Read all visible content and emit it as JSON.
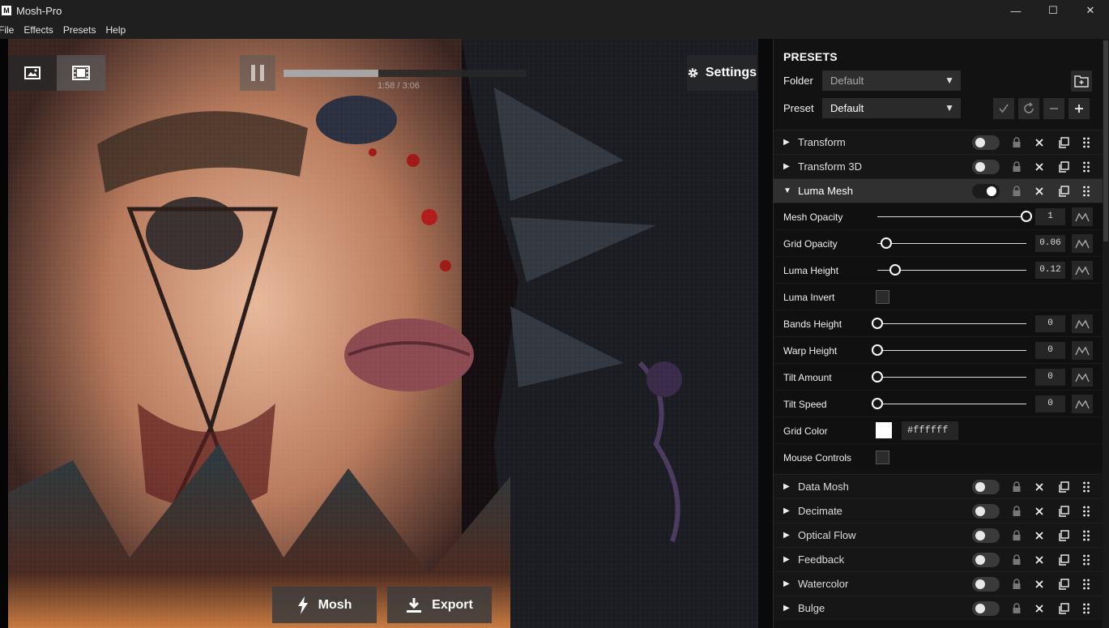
{
  "window": {
    "logo_letter": "M",
    "title": "Mosh-Pro",
    "minimize": "—",
    "maximize": "☐",
    "close": "✕"
  },
  "menu": [
    "File",
    "Effects",
    "Presets",
    "Help"
  ],
  "player": {
    "time": "1:58 / 3:06",
    "progress": 0.39,
    "settings_label": "Settings",
    "mosh_label": "Mosh",
    "export_label": "Export"
  },
  "presets": {
    "title": "PRESETS",
    "folder_label": "Folder",
    "folder_value": "Default",
    "preset_label": "Preset",
    "preset_value": "Default",
    "caret": "▼"
  },
  "effects_top": [
    {
      "name": "Transform",
      "enabled": false,
      "expanded": false
    },
    {
      "name": "Transform 3D",
      "enabled": false,
      "expanded": false
    },
    {
      "name": "Luma Mesh",
      "enabled": true,
      "expanded": true
    }
  ],
  "luma_mesh_params": {
    "mesh_opacity": {
      "label": "Mesh Opacity",
      "value": "1",
      "fraction": 1.0
    },
    "grid_opacity": {
      "label": "Grid Opacity",
      "value": "0.06",
      "fraction": 0.06
    },
    "luma_height": {
      "label": "Luma Height",
      "value": "0.12",
      "fraction": 0.12
    },
    "luma_invert": {
      "label": "Luma Invert",
      "checked": false
    },
    "bands_height": {
      "label": "Bands Height",
      "value": "0",
      "fraction": 0
    },
    "warp_height": {
      "label": "Warp Height",
      "value": "0",
      "fraction": 0
    },
    "tilt_amount": {
      "label": "Tilt Amount",
      "value": "0",
      "fraction": 0
    },
    "tilt_speed": {
      "label": "Tilt Speed",
      "value": "0",
      "fraction": 0
    },
    "grid_color": {
      "label": "Grid Color",
      "value": "#ffffff"
    },
    "mouse_controls": {
      "label": "Mouse Controls",
      "checked": false
    }
  },
  "effects_bottom": [
    {
      "name": "Data Mosh",
      "enabled": false
    },
    {
      "name": "Decimate",
      "enabled": false
    },
    {
      "name": "Optical Flow",
      "enabled": false
    },
    {
      "name": "Feedback",
      "enabled": false
    },
    {
      "name": "Watercolor",
      "enabled": false
    },
    {
      "name": "Bulge",
      "enabled": false
    }
  ],
  "arrows": {
    "collapsed": "▶",
    "expanded": "▼"
  },
  "colors": {
    "panel_bg": "#121212",
    "active_row": "#303030",
    "titlebar": "#1f1f1f"
  }
}
